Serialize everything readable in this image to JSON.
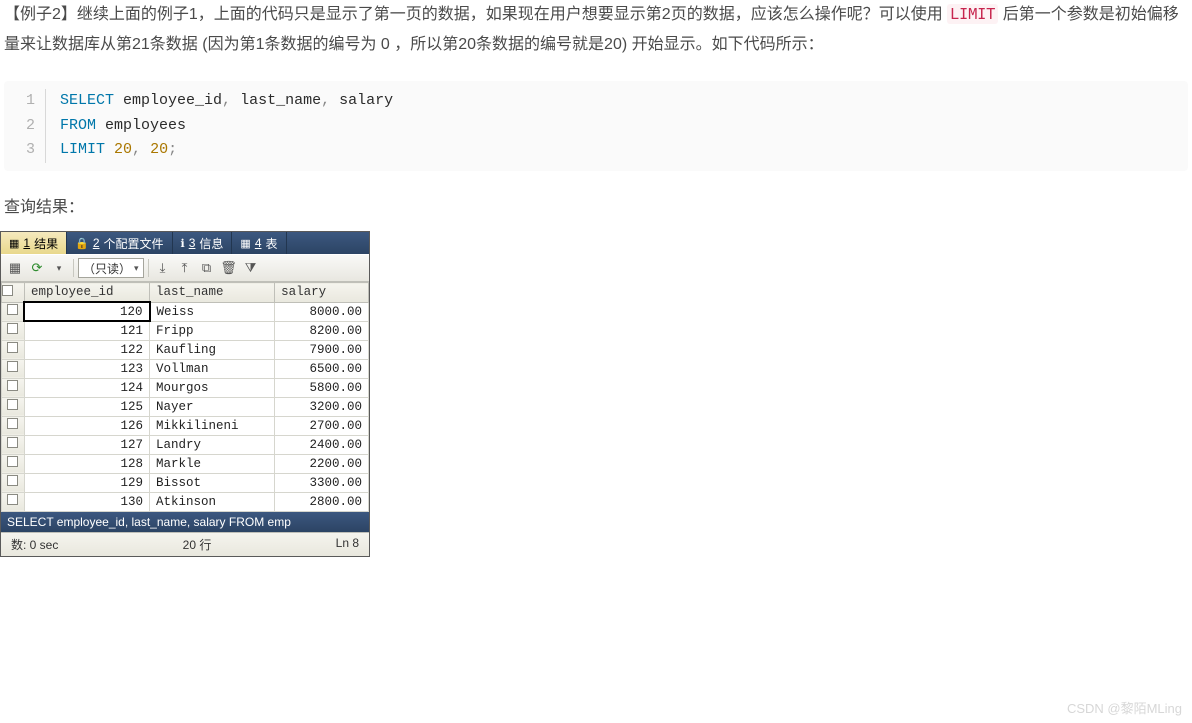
{
  "paragraph": {
    "lead": "【例子2】继续上面的例子1，上面的代码只是显示了第一页的数据，如果现在用户想要显示第2页的数据，应该怎么操作呢？可以使用 ",
    "code_keyword": "LIMIT",
    "tail": " 后第一个参数是初始偏移量来让数据库从第21条数据 (因为第1条数据的编号为 0 ，所以第20条数据的编号就是20) 开始显示。如下代码所示："
  },
  "code": {
    "lines": [
      {
        "n": "1",
        "tokens": [
          {
            "cls": "kw",
            "t": "SELECT"
          },
          {
            "cls": "pln",
            "t": " employee_id"
          },
          {
            "cls": "punct",
            "t": ","
          },
          {
            "cls": "pln",
            "t": " last_name"
          },
          {
            "cls": "punct",
            "t": ","
          },
          {
            "cls": "pln",
            "t": " salary"
          }
        ]
      },
      {
        "n": "2",
        "tokens": [
          {
            "cls": "kw",
            "t": "FROM"
          },
          {
            "cls": "pln",
            "t": " employees"
          }
        ]
      },
      {
        "n": "3",
        "tokens": [
          {
            "cls": "kw",
            "t": "LIMIT"
          },
          {
            "cls": "pln",
            "t": " "
          },
          {
            "cls": "num",
            "t": "20"
          },
          {
            "cls": "punct",
            "t": ","
          },
          {
            "cls": "pln",
            "t": " "
          },
          {
            "cls": "num",
            "t": "20"
          },
          {
            "cls": "punct",
            "t": ";"
          }
        ]
      }
    ]
  },
  "result_label": "查询结果：",
  "dbviewer": {
    "tabs": [
      {
        "icon": "▦",
        "num": "1",
        "label": "结果",
        "active": true
      },
      {
        "icon": "🔒",
        "num": "2",
        "label": "个配置文件",
        "active": false
      },
      {
        "icon": "ℹ",
        "num": "3",
        "label": "信息",
        "active": false
      },
      {
        "icon": "▦",
        "num": "4",
        "label": "表",
        "active": false
      }
    ],
    "toolbar": {
      "readonly_label": "（只读）"
    },
    "columns": [
      "employee_id",
      "last_name",
      "salary"
    ],
    "rows": [
      {
        "employee_id": "120",
        "last_name": "Weiss",
        "salary": "8000.00"
      },
      {
        "employee_id": "121",
        "last_name": "Fripp",
        "salary": "8200.00"
      },
      {
        "employee_id": "122",
        "last_name": "Kaufling",
        "salary": "7900.00"
      },
      {
        "employee_id": "123",
        "last_name": "Vollman",
        "salary": "6500.00"
      },
      {
        "employee_id": "124",
        "last_name": "Mourgos",
        "salary": "5800.00"
      },
      {
        "employee_id": "125",
        "last_name": "Nayer",
        "salary": "3200.00"
      },
      {
        "employee_id": "126",
        "last_name": "Mikkilineni",
        "salary": "2700.00"
      },
      {
        "employee_id": "127",
        "last_name": "Landry",
        "salary": "2400.00"
      },
      {
        "employee_id": "128",
        "last_name": "Markle",
        "salary": "2200.00"
      },
      {
        "employee_id": "129",
        "last_name": "Bissot",
        "salary": "3300.00"
      },
      {
        "employee_id": "130",
        "last_name": "Atkinson",
        "salary": "2800.00"
      }
    ],
    "status_sql": "SELECT employee_id, last_name, salary FROM emp",
    "footer": {
      "left": "数: 0 sec",
      "mid": "20 行",
      "right": "Ln 8"
    }
  },
  "watermark": "CSDN @黎陌MLing"
}
